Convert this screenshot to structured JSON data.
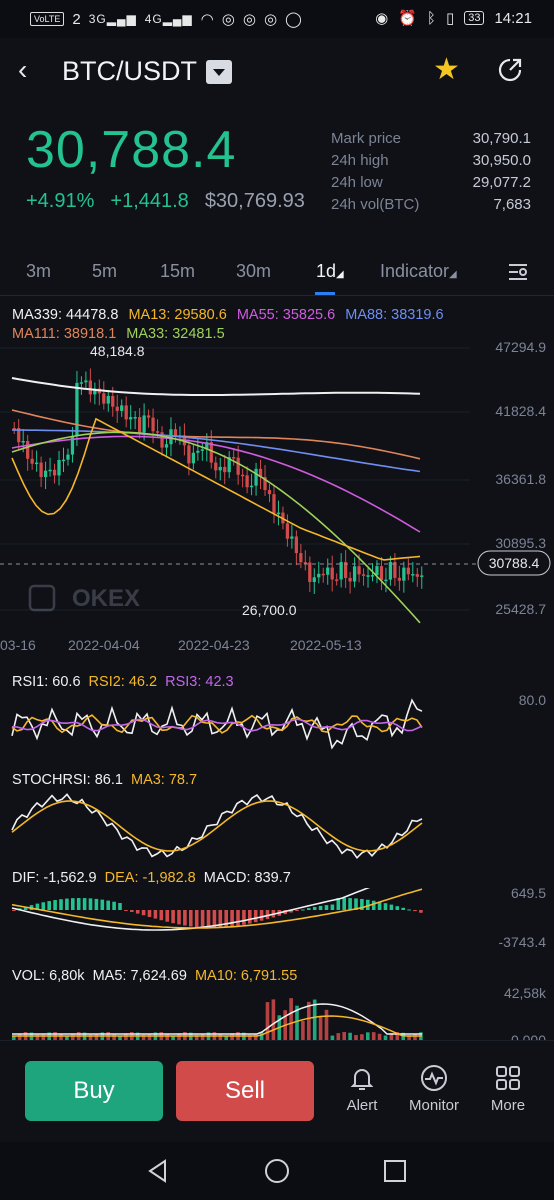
{
  "status_bar": {
    "volte": "VoLTE",
    "sim": "2",
    "net1": "3G",
    "net2": "4G",
    "battery": "33",
    "time": "14:21"
  },
  "header": {
    "pair": "BTC/USDT"
  },
  "price": {
    "last": "30,788.4",
    "change_pct": "+4.91%",
    "change_abs": "+1,441.8",
    "usd_value": "$30,769.93",
    "stats": [
      {
        "label": "Mark price",
        "value": "30,790.1"
      },
      {
        "label": "24h high",
        "value": "30,950.0"
      },
      {
        "label": "24h low",
        "value": "29,077.2"
      },
      {
        "label": "24h vol(BTC)",
        "value": "7,683"
      }
    ]
  },
  "timeframes": [
    "3m",
    "5m",
    "15m",
    "30m",
    "1d",
    "Indicator"
  ],
  "active_timeframe": "1d",
  "ma_legend": {
    "ma339": "MA339: 44478.8",
    "ma13": "MA13: 29580.6",
    "ma55": "MA55: 35825.6",
    "ma88": "MA88: 38319.6",
    "ma111": "MA111: 38918.1",
    "ma33": "MA33: 32481.5"
  },
  "main_chart": {
    "y_ticks": [
      "47294.9",
      "41828.4",
      "36361.8",
      "30895.3",
      "25428.7"
    ],
    "current_price_tag": "30788.4",
    "high_label": "48,184.8",
    "low_label": "26,700.0",
    "watermark": "OKEX",
    "x_ticks": [
      "03-16",
      "2022-04-04",
      "2022-04-23",
      "2022-05-13"
    ]
  },
  "rsi": {
    "rsi1": "RSI1: 60.6",
    "rsi2": "RSI2: 46.2",
    "rsi3": "RSI3: 42.3",
    "axis": "80.0"
  },
  "stochrsi": {
    "label": "STOCHRSI: 86.1",
    "ma3": "MA3: 78.7"
  },
  "macd": {
    "dif": "DIF: -1,562.9",
    "dea": "DEA: -1,982.8",
    "macd": "MACD: 839.7",
    "axis_top": "649.5",
    "axis_bottom": "-3743.4"
  },
  "vol": {
    "vol": "VOL: 6,80k",
    "ma5": "MA5: 7,624.69",
    "ma10": "MA10: 6,791.55",
    "axis_top": "42,58k",
    "axis_bottom": "0.000"
  },
  "actions": {
    "buy": "Buy",
    "sell": "Sell",
    "alert": "Alert",
    "monitor": "Monitor",
    "more": "More"
  },
  "colors": {
    "up": "#23c28f",
    "down": "#d24b4b",
    "accent": "#2a7ff5",
    "star": "#f3c623"
  }
}
